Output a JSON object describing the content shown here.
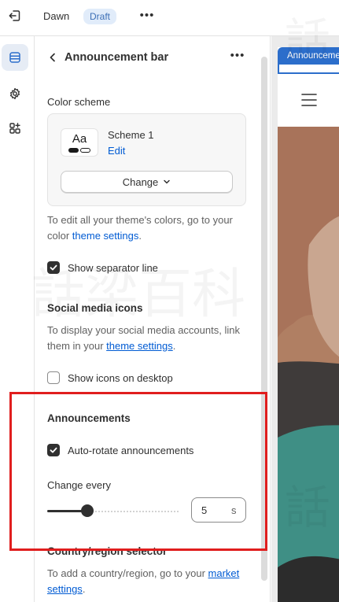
{
  "topbar": {
    "exit_icon": "exit-icon",
    "theme_name": "Dawn",
    "status_badge": "Draft",
    "more_label": "•••"
  },
  "rail": {
    "items": [
      {
        "icon": "sections-icon",
        "active": true
      },
      {
        "icon": "gear-icon",
        "active": false
      },
      {
        "icon": "apps-icon",
        "active": false
      }
    ]
  },
  "panel": {
    "back_icon": "chevron-left-icon",
    "title": "Announcement bar",
    "more_label": "•••",
    "color_scheme": {
      "label": "Color scheme",
      "swatch_text": "Aa",
      "scheme_name": "Scheme 1",
      "edit_link": "Edit",
      "change_button": "Change",
      "help_text_before": "To edit all your theme's colors, go to your color ",
      "help_link": "theme settings",
      "help_text_after": "."
    },
    "show_separator_line": {
      "label": "Show separator line",
      "checked": true
    },
    "social_media": {
      "heading": "Social media icons",
      "help_text_before": "To display your social media accounts, link them in your ",
      "help_link": "theme settings",
      "help_text_after": "."
    },
    "show_icons_on_desktop": {
      "label": "Show icons on desktop",
      "checked": false
    },
    "announcements": {
      "heading": "Announcements",
      "auto_rotate": {
        "label": "Auto-rotate announcements",
        "checked": true
      },
      "change_every_label": "Change every",
      "change_every_value": "5",
      "change_every_unit": "s"
    },
    "country_region": {
      "heading": "Country/region selector",
      "help_text_before": "To add a country/region, go to your ",
      "help_link": "market settings",
      "help_text_after": "."
    }
  },
  "preview": {
    "tab_label": "Announcement bar",
    "menu_icon": "hamburger-menu-icon"
  },
  "colors": {
    "accent_blue": "#2c6ecb",
    "link_blue": "#005bd3",
    "highlight_red": "#e01e1e",
    "draft_badge_bg": "#e1ecfa"
  }
}
